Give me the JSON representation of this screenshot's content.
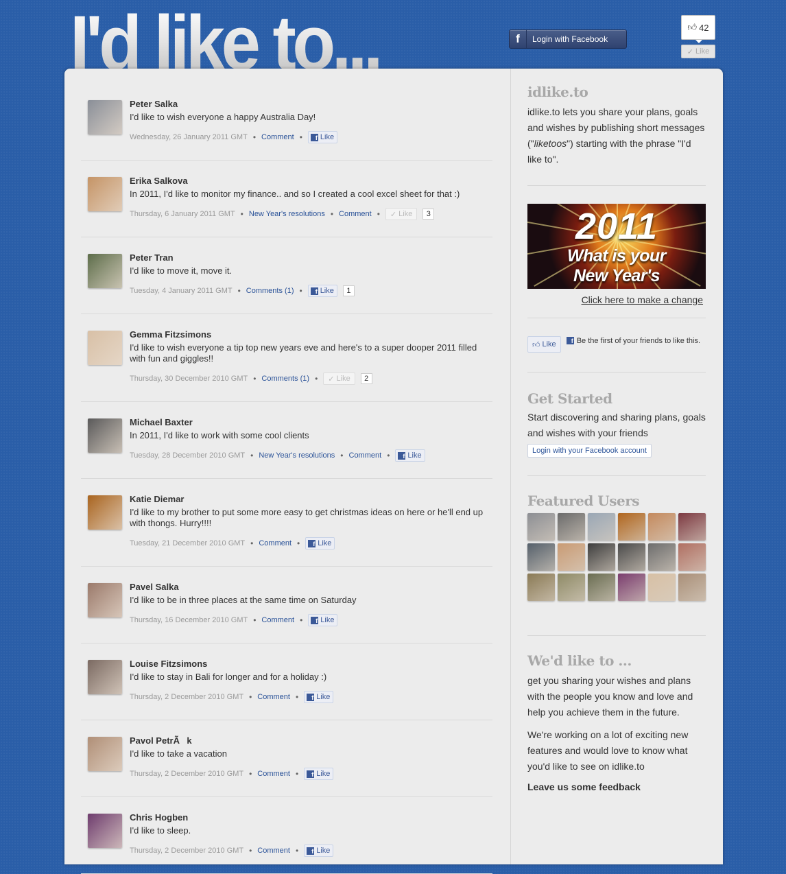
{
  "header": {
    "logo_text": "I'd like to...",
    "fb_login_label": "Login with Facebook",
    "fb_login_icon": "f",
    "page_like_count": "42",
    "page_like_label": "Like"
  },
  "posts": [
    {
      "name": "Peter Salka",
      "message": "I'd like to wish everyone a happy Australia Day!",
      "date": "Wednesday, 26 January 2011 GMT",
      "tag": "",
      "comment_label": "Comment",
      "like_label": "Like",
      "liked": false,
      "like_count": "",
      "avatar_color": "#8a8f98"
    },
    {
      "name": "Erika Salkova",
      "message": "In 2011, I'd like to monitor my finance.. and so I created a cool excel sheet for that :)",
      "date": "Thursday, 6 January 2011 GMT",
      "tag": "New Year's resolutions",
      "comment_label": "Comment",
      "like_label": "Like",
      "liked": true,
      "like_count": "3",
      "avatar_color": "#c59466"
    },
    {
      "name": "Peter Tran",
      "message": "I'd like to move it, move it.",
      "date": "Tuesday, 4 January 2011 GMT",
      "tag": "",
      "comment_label": "Comments (1)",
      "like_label": "Like",
      "liked": false,
      "like_count": "1",
      "avatar_color": "#5d6d4a"
    },
    {
      "name": "Gemma Fitzsimons",
      "message": "I'd like to wish everyone a tip top new years eve and here's to a super dooper 2011 filled with fun and giggles!!",
      "date": "Thursday, 30 December 2010 GMT",
      "tag": "",
      "comment_label": "Comments (1)",
      "like_label": "Like",
      "liked": true,
      "like_count": "2",
      "avatar_color": "#d8c0a6"
    },
    {
      "name": "Michael Baxter",
      "message": "In 2011, I'd like to work with some cool clients",
      "date": "Tuesday, 28 December 2010 GMT",
      "tag": "New Year's resolutions",
      "comment_label": "Comment",
      "like_label": "Like",
      "liked": false,
      "like_count": "",
      "avatar_color": "#5a5a5a"
    },
    {
      "name": "Katie Diemar",
      "message": "I'd like to my brother to put some more easy to get christmas ideas on here or he'll end up with thongs. Hurry!!!!",
      "date": "Tuesday, 21 December 2010 GMT",
      "tag": "",
      "comment_label": "Comment",
      "like_label": "Like",
      "liked": false,
      "like_count": "",
      "avatar_color": "#a9641f"
    },
    {
      "name": "Pavel Salka",
      "message": "I'd like to be in three places at the same time on Saturday",
      "date": "Thursday, 16 December 2010 GMT",
      "tag": "",
      "comment_label": "Comment",
      "like_label": "Like",
      "liked": false,
      "like_count": "",
      "avatar_color": "#9b7a6b"
    },
    {
      "name": "Louise Fitzsimons",
      "message": "I'd like to stay in Bali for longer and for a holiday :)",
      "date": "Thursday, 2 December 2010 GMT",
      "tag": "",
      "comment_label": "Comment",
      "like_label": "Like",
      "liked": false,
      "like_count": "",
      "avatar_color": "#7b6a62"
    },
    {
      "name": "Pavol PetrÃk",
      "message": "I'd like to take a vacation",
      "date": "Thursday, 2 December 2010 GMT",
      "tag": "",
      "comment_label": "Comment",
      "like_label": "Like",
      "liked": false,
      "like_count": "",
      "avatar_color": "#b08f77"
    },
    {
      "name": "Chris Hogben",
      "message": "I'd like to sleep.",
      "date": "Thursday, 2 December 2010 GMT",
      "tag": "",
      "comment_label": "Comment",
      "like_label": "Like",
      "liked": false,
      "like_count": "",
      "avatar_color": "#6e3c6e"
    }
  ],
  "sidebar": {
    "about_title": "idlike.to",
    "about_text_1": "idlike.to lets you share your plans, goals and wishes by publishing short messages (\"",
    "about_text_em": "liketoos",
    "about_text_2": "\") starting with the phrase \"I'd like to\".",
    "promo_year": "2011",
    "promo_line1": "What is your",
    "promo_line2": "New Year's Resolution?",
    "promo_link": "Click here to make a change",
    "social_like_label": "Like",
    "social_text": "Be the first of your friends to like this.",
    "get_started_title": "Get Started",
    "get_started_text": "Start discovering and sharing plans, goals and wishes with your friends",
    "get_started_button": "Login with your Facebook account",
    "featured_title": "Featured Users",
    "featured_colors": [
      "#8d8f94",
      "#6b6b6b",
      "#9aa7b5",
      "#b0661f",
      "#c48a5e",
      "#7d3a42",
      "#55606b",
      "#c99b74",
      "#3e3e3e",
      "#4a4a4a",
      "#6d6d6d",
      "#b06f62",
      "#8a7a55",
      "#8e8a66",
      "#6a6d52",
      "#7a3d6e",
      "#d7c0a5",
      "#a98f78"
    ],
    "wed_like_title": "We'd like to ...",
    "wed_like_text_1": "get you sharing your wishes and plans with the people you know and love and help you achieve them in the future.",
    "wed_like_text_2": "We're working on a lot of exciting new features and would love to know what you'd like to see on idlike.to",
    "feedback_link": "Leave us some feedback"
  },
  "colors": {
    "page_bg": "#2a5ea8",
    "panel_bg": "#ececec",
    "link": "#2a5298",
    "fb_blue": "#3b5998"
  }
}
